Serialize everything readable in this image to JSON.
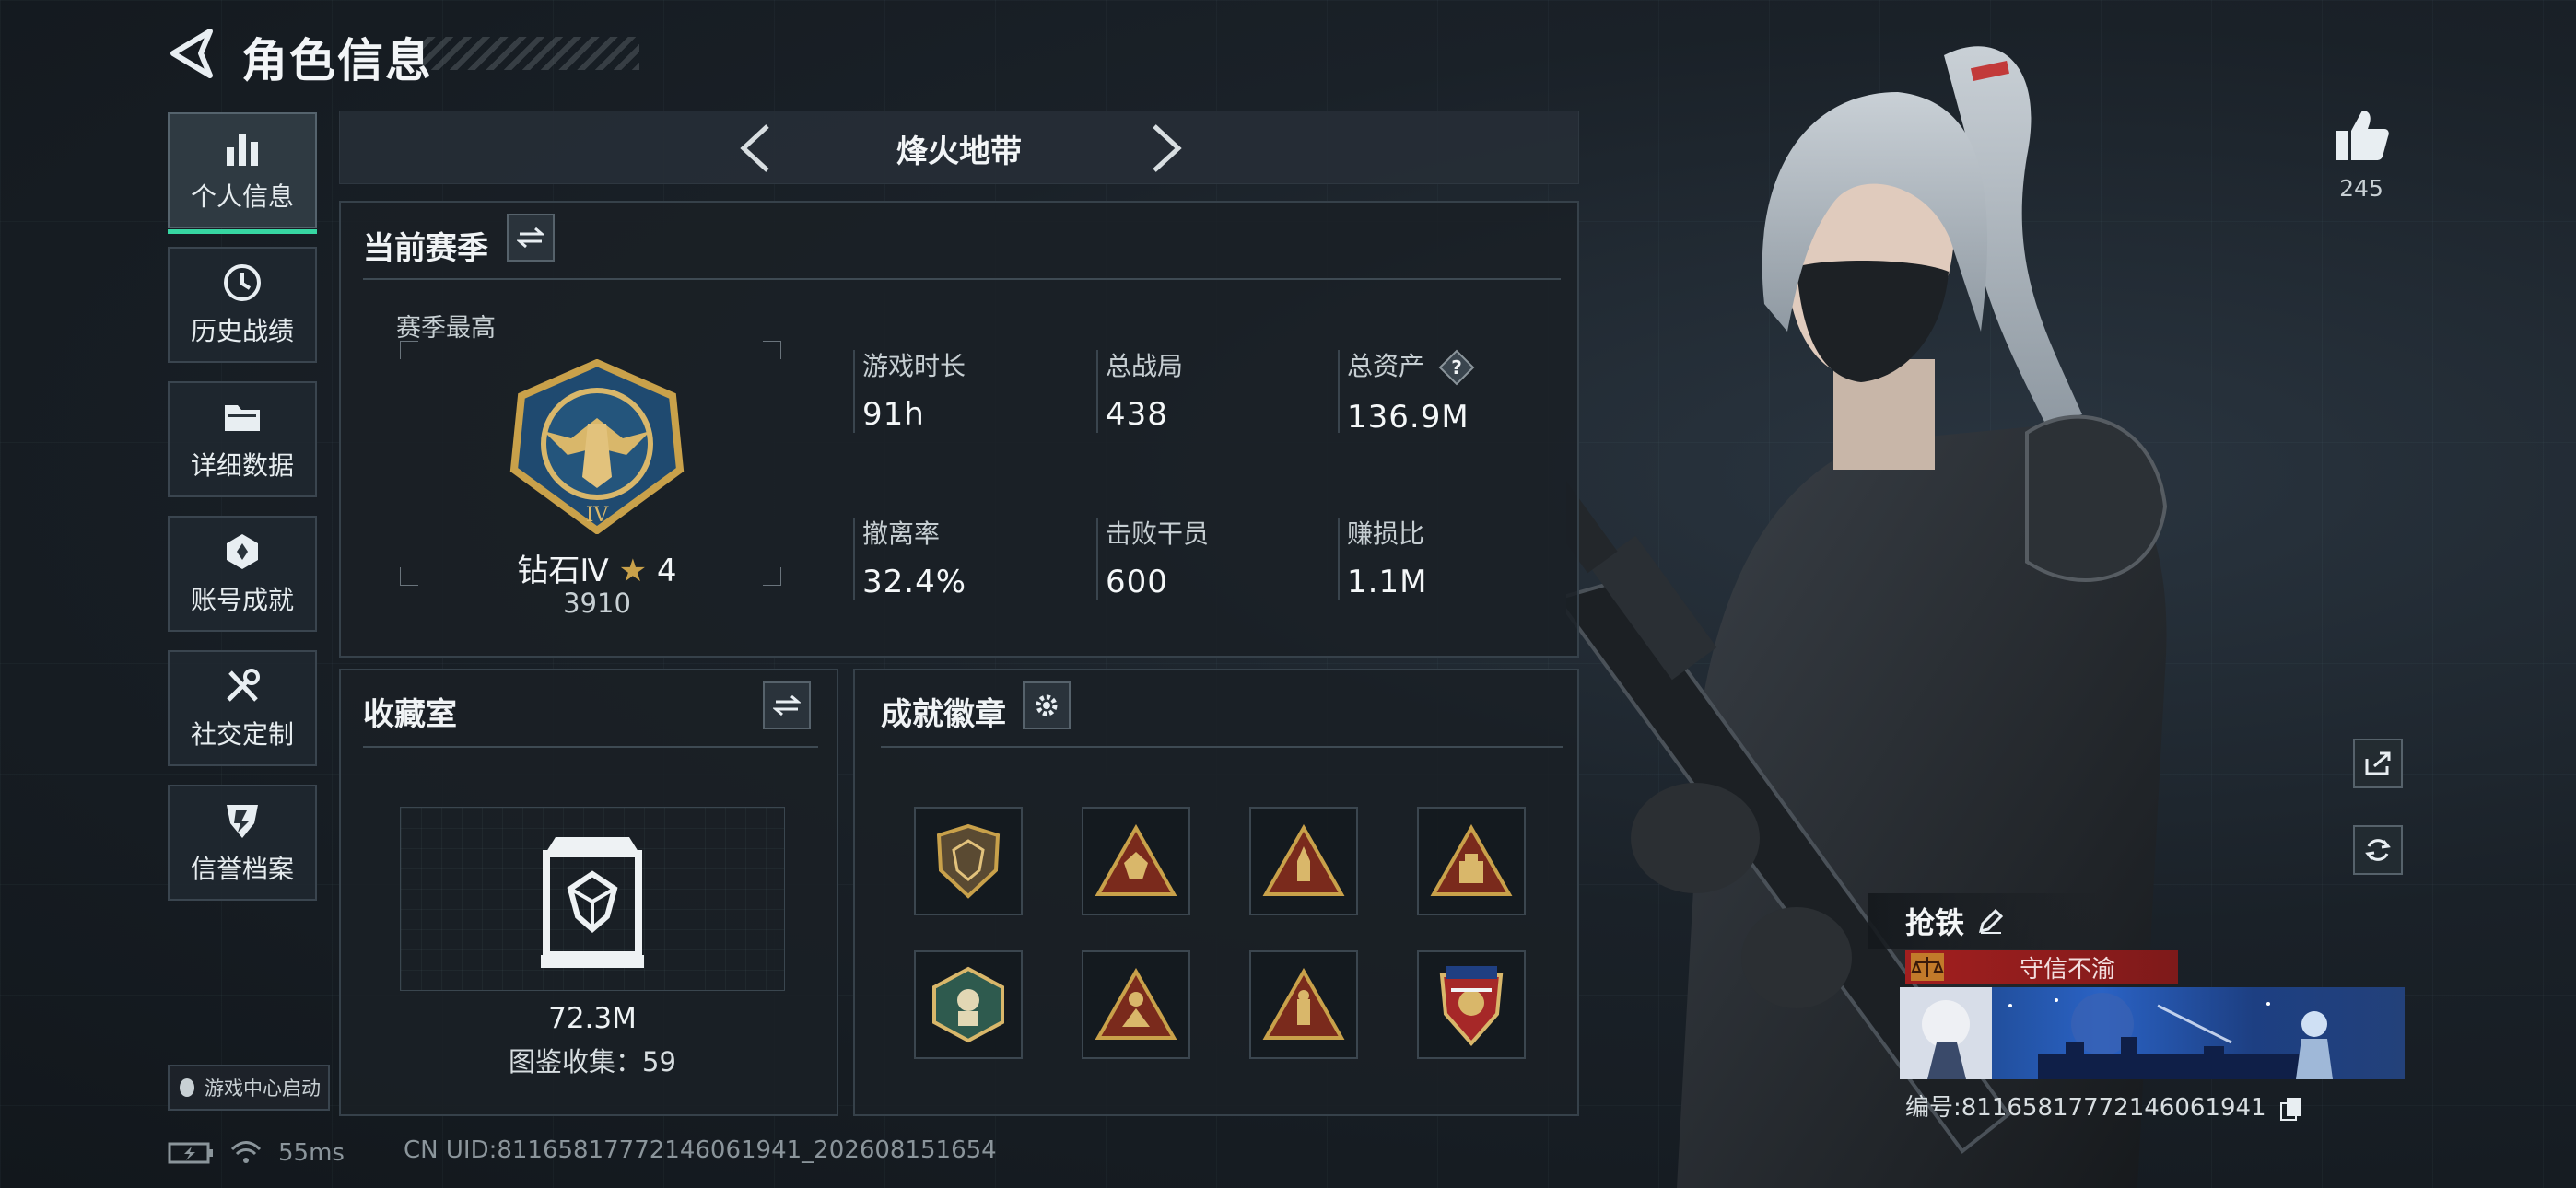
{
  "header": {
    "title": "角色信息"
  },
  "nav": {
    "items": [
      {
        "label": "个人信息",
        "icon": "bar-chart-icon",
        "active": true
      },
      {
        "label": "历史战绩",
        "icon": "history-clock-icon",
        "active": false
      },
      {
        "label": "详细数据",
        "icon": "folder-icon",
        "active": false
      },
      {
        "label": "账号成就",
        "icon": "achievement-icon",
        "active": false
      },
      {
        "label": "社交定制",
        "icon": "tools-icon",
        "active": false
      },
      {
        "label": "信誉档案",
        "icon": "shield-badge-icon",
        "active": false
      }
    ],
    "game_center_label": "游戏中心启动"
  },
  "mode": {
    "title": "烽火地带"
  },
  "season": {
    "title": "当前赛季",
    "subtitle": "赛季最高",
    "rank_name": "钻石Ⅳ",
    "rank_stars": "4",
    "rank_points": "3910",
    "stats": [
      {
        "label": "游戏时长",
        "value": "91h"
      },
      {
        "label": "总战局",
        "value": "438"
      },
      {
        "label": "总资产",
        "value": "136.9M"
      },
      {
        "label": "撤离率",
        "value": "32.4%"
      },
      {
        "label": "击败干员",
        "value": "600"
      },
      {
        "label": "赚损比",
        "value": "1.1M"
      }
    ]
  },
  "collection": {
    "title": "收藏室",
    "value": "72.3M",
    "count_text": "图鉴收集：59"
  },
  "badges": {
    "title": "成就徽章"
  },
  "status": {
    "ping": "55ms",
    "uid": "CN UID:81165817772146061941_202608151654"
  },
  "profile": {
    "likes": "245",
    "player_name": "抢铁",
    "title_text": "守信不渝",
    "id_text": "编号:81165817772146061941"
  },
  "colors": {
    "accent": "#37d6a2",
    "title_red": "#a21f1f",
    "gold": "#c9a14a"
  }
}
